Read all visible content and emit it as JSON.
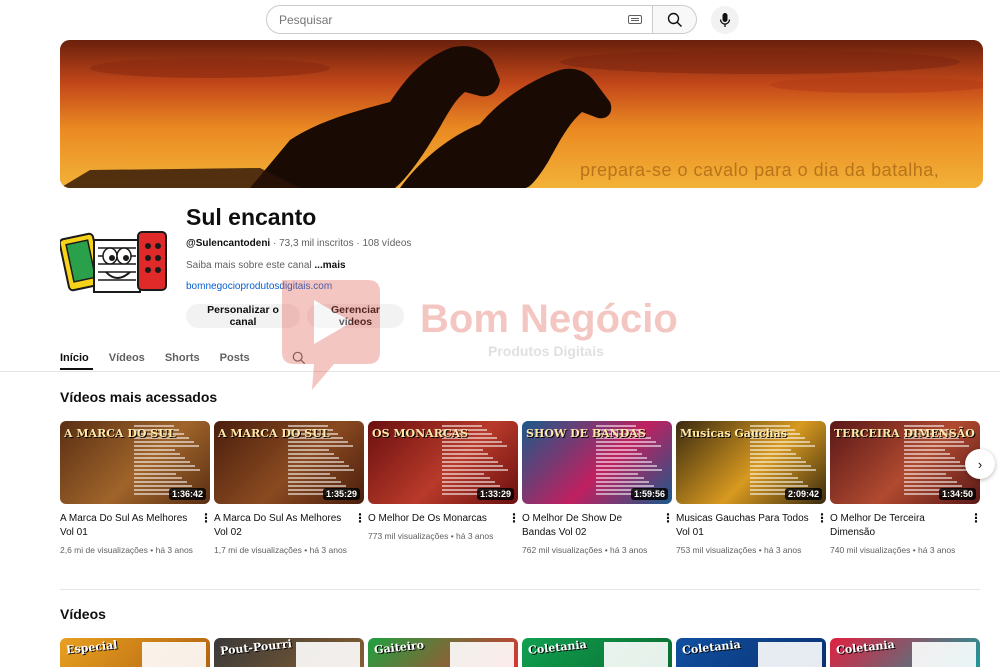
{
  "search": {
    "placeholder": "Pesquisar",
    "icons": [
      "keyboard-icon",
      "search-icon",
      "mic-icon"
    ]
  },
  "banner": {
    "text": "prepara-se o cavalo para o dia da batalha,"
  },
  "channel": {
    "name": "Sul encanto",
    "handle": "@Sulencantodeni",
    "subscribers": "73,3 mil inscritos",
    "videos_count": "108 vídeos",
    "about": "Saiba mais sobre este canal",
    "more": "...mais",
    "link": "bomnegocioprodutosdigitais.com",
    "buttons": {
      "customize": "Personalizar o canal",
      "manage": "Gerenciar vídeos"
    }
  },
  "tabs": [
    "Início",
    "Vídeos",
    "Shorts",
    "Posts"
  ],
  "watermark": {
    "brand": "Bom Negócio",
    "tagline": "Produtos Digitais"
  },
  "sections": {
    "popular": "Vídeos mais acessados",
    "videos": "Vídeos"
  },
  "popular_videos": [
    {
      "title": "A Marca Do Sul As Melhores Vol 01",
      "duration": "1:36:42",
      "views": "2,6 mi de visualizações",
      "age": "há 3 anos",
      "thumb_label": "A MARCA DO SUL",
      "color_a": "#5a2f14",
      "color_b": "#a0642a"
    },
    {
      "title": "A Marca Do Sul As Melhores Vol 02",
      "duration": "1:35:29",
      "views": "1,7 mi de visualizações",
      "age": "há 3 anos",
      "thumb_label": "A MARCA DO SUL",
      "color_a": "#4a1e0e",
      "color_b": "#8a4a20"
    },
    {
      "title": "O Melhor De Os Monarcas",
      "duration": "1:33:29",
      "views": "773 mil visualizações",
      "age": "há 3 anos",
      "thumb_label": "OS MONARCAS",
      "color_a": "#6a1010",
      "color_b": "#b83a2a"
    },
    {
      "title": "O Melhor De Show De Bandas Vol 02",
      "duration": "1:59:56",
      "views": "762 mil visualizações",
      "age": "há 3 anos",
      "thumb_label": "SHOW DE BANDAS",
      "color_a": "#1a5a8a",
      "color_b": "#c02060"
    },
    {
      "title": "Musicas Gauchas Para Todos Vol 01",
      "duration": "2:09:42",
      "views": "753 mil visualizações",
      "age": "há 3 anos",
      "thumb_label": "Musicas Gauchas",
      "color_a": "#3a2a10",
      "color_b": "#d89a20"
    },
    {
      "title": "O Melhor De Terceira Dimensão",
      "duration": "1:34:50",
      "views": "740 mil visualizações",
      "age": "há 3 anos",
      "thumb_label": "TERCEIRA DIMENSÃO",
      "color_a": "#5a1818",
      "color_b": "#b04a30"
    }
  ],
  "bottom_videos": [
    {
      "thumb_label": "Especial",
      "color_a": "#e8a020",
      "color_b": "#b06010"
    },
    {
      "thumb_label": "Pout-Pourri",
      "color_a": "#3a3a3a",
      "color_b": "#8a6030"
    },
    {
      "thumb_label": "Gaiteiro",
      "color_a": "#20a040",
      "color_b": "#e03030"
    },
    {
      "thumb_label": "Coletania",
      "color_a": "#10a050",
      "color_b": "#0a6a30"
    },
    {
      "thumb_label": "Coletania",
      "color_a": "#1050a0",
      "color_b": "#0a3070"
    },
    {
      "thumb_label": "Coletania",
      "color_a": "#e02040",
      "color_b": "#10a0a0"
    }
  ]
}
